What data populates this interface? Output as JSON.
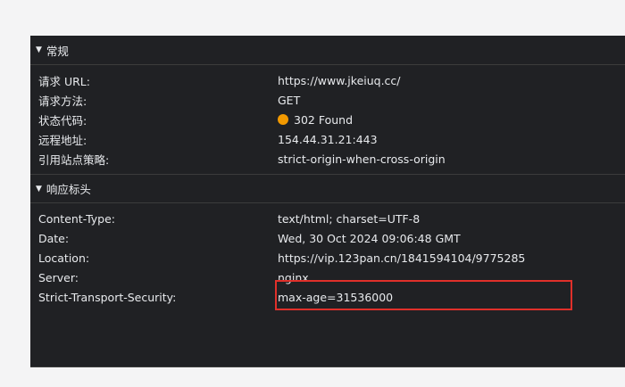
{
  "general": {
    "header": "常规",
    "rows": [
      {
        "key": "请求 URL:",
        "value": "https://www.jkeiuq.cc/"
      },
      {
        "key": "请求方法:",
        "value": "GET"
      },
      {
        "key": "状态代码:",
        "value": "302 Found"
      },
      {
        "key": "远程地址:",
        "value": "154.44.31.21:443"
      },
      {
        "key": "引用站点策略:",
        "value": "strict-origin-when-cross-origin"
      }
    ]
  },
  "response_headers": {
    "header": "响应标头",
    "rows": [
      {
        "key": "Content-Type:",
        "value": "text/html; charset=UTF-8"
      },
      {
        "key": "Date:",
        "value": "Wed, 30 Oct 2024 09:06:48 GMT"
      },
      {
        "key": "Location:",
        "value": "https://vip.123pan.cn/1841594104/9775285"
      },
      {
        "key": "Server:",
        "value": "nginx"
      },
      {
        "key": "Strict-Transport-Security:",
        "value": "max-age=31536000"
      }
    ]
  },
  "colors": {
    "status_dot": "#f29900",
    "highlight": "#e0302a",
    "panel_bg": "#202124"
  }
}
